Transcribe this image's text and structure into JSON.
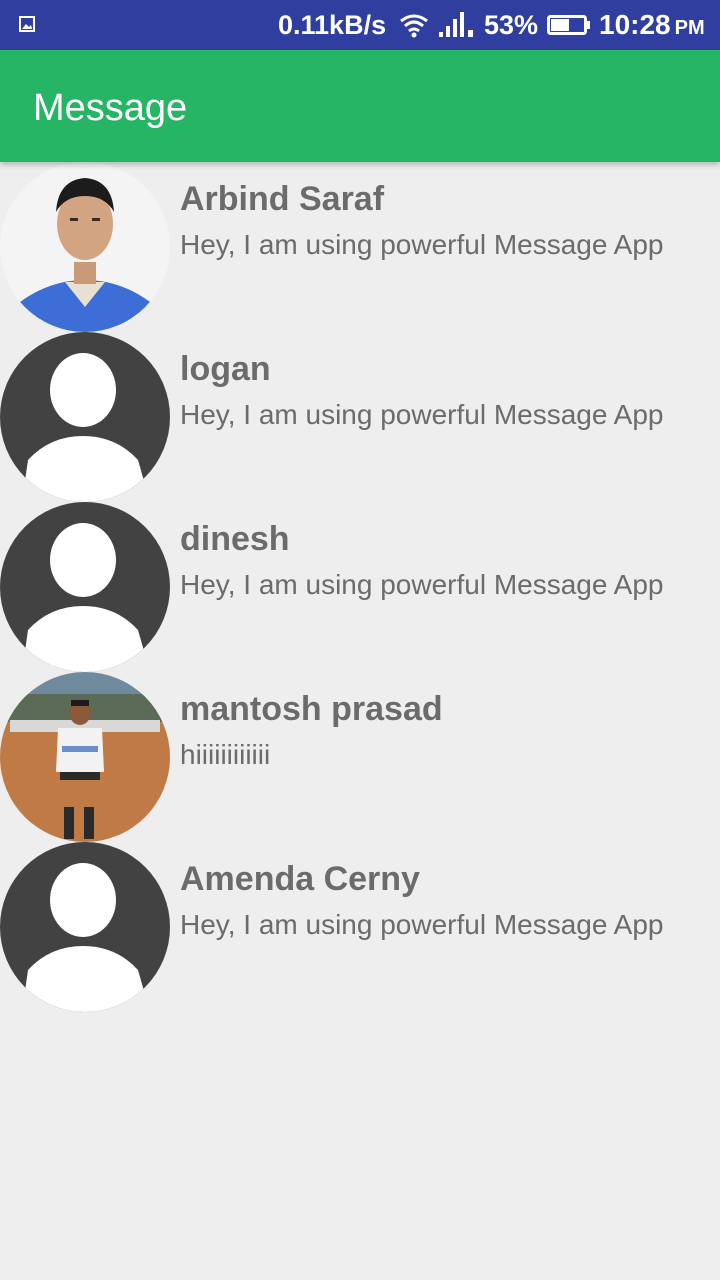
{
  "status_bar": {
    "network_speed": "0.11kB/s",
    "battery_percent": "53%",
    "time": "10:28",
    "ampm": "PM",
    "background_color": "#303f9f",
    "icons": [
      "gallery-icon",
      "wifi-icon",
      "signal-icon",
      "battery-icon"
    ]
  },
  "app_bar": {
    "title": "Message",
    "background_color": "#25b565"
  },
  "contacts": [
    {
      "name": "Arbind Saraf",
      "status": "Hey, I am using powerful Message App",
      "avatar": "profile-photo"
    },
    {
      "name": "logan",
      "status": "Hey, I am using powerful Message App",
      "avatar": "default-avatar-icon"
    },
    {
      "name": "dinesh",
      "status": "Hey, I am using powerful Message App",
      "avatar": "default-avatar-icon"
    },
    {
      "name": "mantosh prasad",
      "status": "hiiiiiiiiiiii",
      "avatar": "profile-photo"
    },
    {
      "name": "Amenda Cerny",
      "status": "Hey, I am using powerful Message App",
      "avatar": "default-avatar-icon"
    }
  ]
}
